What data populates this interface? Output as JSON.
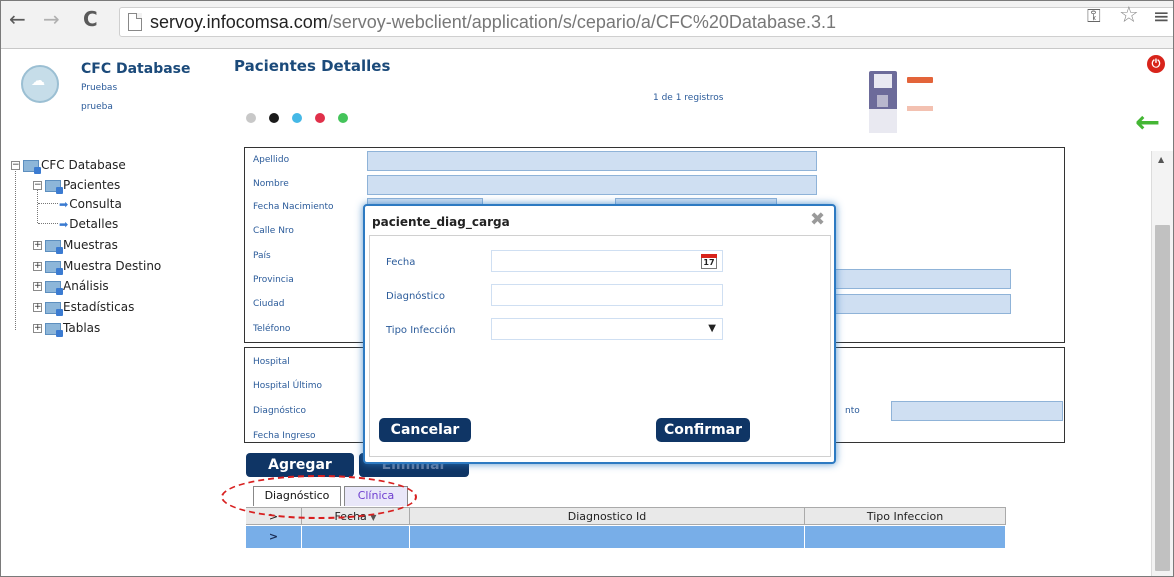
{
  "browser": {
    "back_icon": "←",
    "forward_icon": "→",
    "reload_icon": "C",
    "url_host": "servoy.infocomsa.com",
    "url_path": "/servoy-webclient/application/s/cepario/a/CFC%20Database.3.1",
    "key_icon": "key-icon",
    "star_icon": "star-icon",
    "menu_icon": "menu-icon"
  },
  "header": {
    "app_title": "CFC Database",
    "subtitle_1": "Pruebas",
    "subtitle_2": "prueba",
    "page_title": "Pacientes Detalles",
    "records_label": "1 de 1 registros",
    "dot_colors": [
      "#c8c8c8",
      "#1a1a1a",
      "#45b8e6",
      "#e0304a",
      "#44c45a"
    ]
  },
  "tree": {
    "root": "CFC Database",
    "pacientes": "Pacientes",
    "consulta": "Consulta",
    "detalles": "Detalles",
    "muestras": "Muestras",
    "muestra_destino": "Muestra Destino",
    "analisis": "Análisis",
    "estadisticas": "Estadísticas",
    "tablas": "Tablas"
  },
  "form": {
    "apellido": "Apellido",
    "nombre": "Nombre",
    "fecha_nacimiento": "Fecha Nacimiento",
    "calle_nro": "Calle Nro",
    "pais": "País",
    "provincia": "Provincia",
    "ciudad": "Ciudad",
    "telefono": "Teléfono",
    "hospital": "Hospital",
    "hospital_ultimo": "Hospital Último",
    "diagnostico": "Diagnóstico",
    "fecha_ingreso": "Fecha Ingreso",
    "nto_fragment": "nto"
  },
  "actions": {
    "agregar": "Agregar",
    "eliminar": "Eliminar"
  },
  "tabs": [
    "Diagnóstico",
    "Clínica"
  ],
  "grid": {
    "headers": [
      ">",
      "Fecha",
      "Diagnostico Id",
      "Tipo Infeccion"
    ],
    "row_marker": ">"
  },
  "dialog": {
    "title": "paciente_diag_carga",
    "close_icon": "✖",
    "fecha_label": "Fecha",
    "fecha_value": "",
    "calendar_day": "17",
    "diagnostico_label": "Diagnóstico",
    "diagnostico_value": "",
    "tipo_label": "Tipo Infección",
    "tipo_value": "",
    "cancel": "Cancelar",
    "confirm": "Confirmar"
  },
  "colors": {
    "accent_blue": "#1b4a7a",
    "button_navy": "#0f3565",
    "selected_row": "#78aee8",
    "annotation_red": "#d82020"
  }
}
